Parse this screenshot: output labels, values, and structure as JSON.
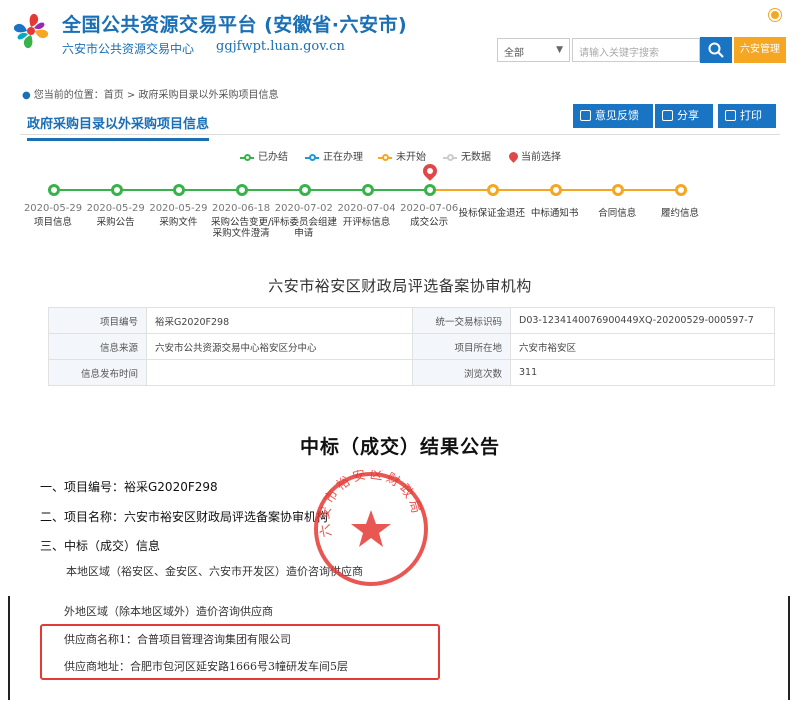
{
  "header": {
    "title": "全国公共资源交易平台 (安徽省·六安市)",
    "subtitle": "六安市公共资源交易中心",
    "url": "ggjfwpt.luan.gov.cn",
    "search": {
      "scope": "全部",
      "placeholder": "请输入关键字搜索",
      "manage_label": "六安管理"
    },
    "colors": {
      "brand": "#1a6fb5",
      "accent": "#f5a623"
    }
  },
  "breadcrumb": {
    "text": "您当前的位置：首页 > 政府采购目录以外采购项目信息"
  },
  "page_tab": {
    "title": "政府采购目录以外采购项目信息"
  },
  "actions": {
    "feedback": "意见反馈",
    "share": "分享",
    "print": "打印"
  },
  "legend": {
    "done": "已办结",
    "doing": "正在办理",
    "todo": "未开始",
    "none": "无数据",
    "current": "当前选择",
    "colors": {
      "done": "#38b24a",
      "doing": "#1a9ad6",
      "todo": "#f5a623",
      "none": "#cccccc",
      "current": "#e04848"
    }
  },
  "timeline": [
    {
      "date": "2020-05-29",
      "label": "项目信息",
      "status": "done"
    },
    {
      "date": "2020-05-29",
      "label": "采购公告",
      "status": "done"
    },
    {
      "date": "2020-05-29",
      "label": "采购文件",
      "status": "done"
    },
    {
      "date": "2020-06-18",
      "label": "采购公告变更/采购文件澄清",
      "status": "done"
    },
    {
      "date": "2020-07-02",
      "label": "评标委员会组建申请",
      "status": "done"
    },
    {
      "date": "2020-07-04",
      "label": "开评标信息",
      "status": "done"
    },
    {
      "date": "2020-07-06",
      "label": "成交公示",
      "status": "done",
      "current": true
    },
    {
      "date": "",
      "label": "投标保证金退还",
      "status": "todo"
    },
    {
      "date": "",
      "label": "中标通知书",
      "status": "todo"
    },
    {
      "date": "",
      "label": "合同信息",
      "status": "todo"
    },
    {
      "date": "",
      "label": "履约信息",
      "status": "todo"
    }
  ],
  "org_title": "六安市裕安区财政局评选备案协审机构",
  "info": {
    "project_no_label": "项目编号",
    "project_no": "裕采G2020F298",
    "uid_label": "统一交易标识码",
    "uid": "D03-1234140076900449XQ-20200529-000597-7",
    "source_label": "信息来源",
    "source": "六安市公共资源交易中心裕安区分中心",
    "location_label": "项目所在地",
    "location": "六安市裕安区",
    "publish_time_label": "信息发布时间",
    "publish_time": "",
    "views_label": "浏览次数",
    "views": "311"
  },
  "announcement": {
    "title": "中标（成交）结果公告",
    "line1": "一、项目编号：裕采G2020F298",
    "line2": "二、项目名称：六安市裕安区财政局评选备案协审机构",
    "line3": "三、中标（成交）信息",
    "local_suppliers": "本地区域（裕安区、金安区、六安市开发区）造价咨询供应商",
    "external_suppliers": "外地区域（除本地区域外）造价咨询供应商",
    "supplier_name": "供应商名称1：合普项目管理咨询集团有限公司",
    "supplier_address": "供应商地址：合肥市包河区延安路1666号3幢研发车间5层",
    "stamp_text": "六安市裕安区财政局"
  }
}
